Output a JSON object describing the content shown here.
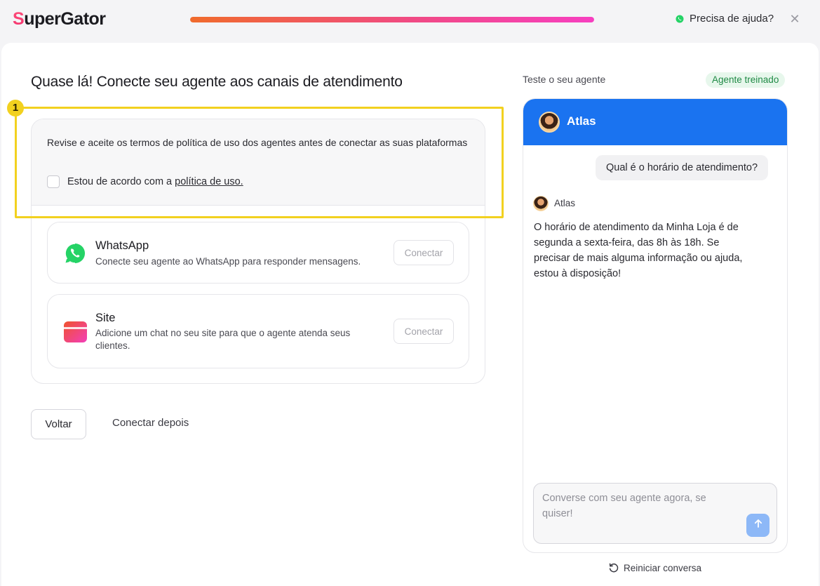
{
  "header": {
    "logo_initial": "S",
    "logo_rest": "uperGator",
    "progress": 1.0,
    "help_label": "Precisa de ajuda?",
    "close_glyph": "✕"
  },
  "page": {
    "title": "Quase lá! Conecte seu agente aos canais de atendimento"
  },
  "terms": {
    "text": "Revise e aceite os termos de política de uso dos agentes antes de conectar as suas plataformas",
    "checkbox_label_prefix": "Estou de acordo com a ",
    "policy_link": "política de uso.",
    "checked": false
  },
  "channels": [
    {
      "icon": "whatsapp-icon",
      "title": "WhatsApp",
      "description": "Conecte seu agente ao WhatsApp para responder mensagens.",
      "button": "Conectar"
    },
    {
      "icon": "site-chat-icon",
      "title": "Site",
      "description": "Adicione um chat no seu site para que o agente atenda seus clientes.",
      "button": "Conectar"
    }
  ],
  "annotation": {
    "badge": "1",
    "color": "#f2d11f"
  },
  "actions": {
    "back": "Voltar",
    "later": "Conectar depois"
  },
  "test_panel": {
    "label": "Teste o seu agente",
    "status_badge": "Agente treinado",
    "agent_name": "Atlas",
    "user_message": "Qual é o horário de atendimento?",
    "agent_label": "Atlas",
    "agent_message": "O horário de atendimento da Minha Loja é de segunda a sexta-feira, das 8h às 18h. Se precisar de mais alguma informação ou ajuda, estou à disposição!",
    "input_placeholder": "Converse com seu agente agora, se quiser!",
    "restart": "Reiniciar conversa"
  },
  "colors": {
    "accent_blue": "#1a73f0",
    "whatsapp_green": "#25d366",
    "success_text": "#1f8a45",
    "success_bg": "#e7f7ec"
  }
}
